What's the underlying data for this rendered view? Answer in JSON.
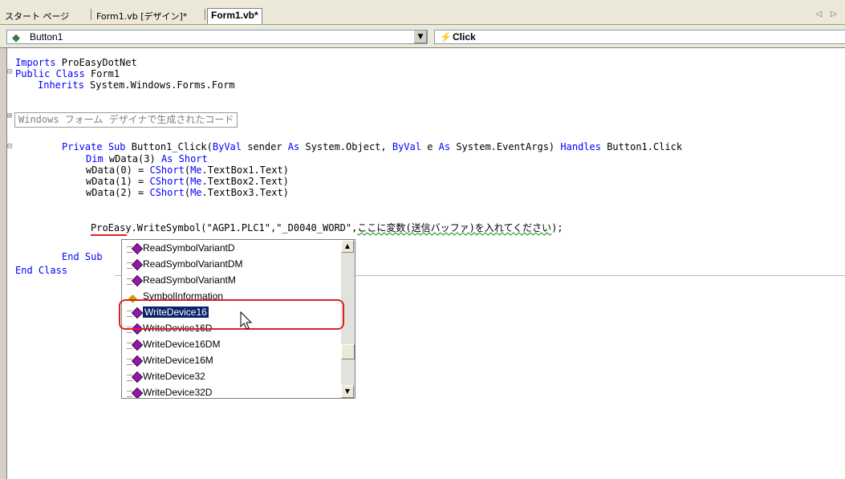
{
  "tabs": [
    "スタート ページ",
    "Form1.vb [デザイン]*",
    "Form1.vb*"
  ],
  "tab_nav": "◁ ▷",
  "object_combo": "Button1",
  "event_combo": "Click",
  "code": {
    "l1_kw": "Imports",
    "l1_rest": " ProEasyDotNet",
    "l2_kw1": "Public",
    "l2_kw2": "Class",
    "l2_rest": " Form1",
    "l3_kw": "Inherits",
    "l3_rest": " System.Windows.Forms.Form",
    "region": "Windows フォーム デザイナで生成されたコード",
    "l5_kw1": "Private",
    "l5_kw2": "Sub",
    "l5_a": " Button1_Click(",
    "l5_kw3": "ByVal",
    "l5_b": " sender ",
    "l5_kw4": "As",
    "l5_c": " System.Object, ",
    "l5_kw5": "ByVal",
    "l5_d": " e ",
    "l5_kw6": "As",
    "l5_e": " System.EventArgs) ",
    "l5_kw7": "Handles",
    "l5_f": " Button1.Click",
    "l6_kw1": "Dim",
    "l6_a": " wData(3) ",
    "l6_kw2": "As",
    "l6_kw3": "Short",
    "l7_a": "wData(0) = ",
    "l7_kw1": "CShort",
    "l7_b": "(",
    "l7_kw2": "Me",
    "l7_c": ".TextBox1.Text)",
    "l8_a": "wData(1) = ",
    "l8_kw1": "CShort",
    "l8_b": "(",
    "l8_kw2": "Me",
    "l8_c": ".TextBox2.Text)",
    "l9_a": "wData(2) = ",
    "l9_kw1": "CShort",
    "l9_b": "(",
    "l9_kw2": "Me",
    "l9_c": ".TextBox3.Text)",
    "l10_a": "ProEasy.",
    "l10_b": "WriteSymbol",
    "l10_c": "(\"AGP1.PLC1\",\"_D0040_WORD\",",
    "l10_d": "ここに変数(送信バッファ)を入れてください",
    "l10_e": ");",
    "end_sub_kw1": "End",
    "end_sub_kw2": "Sub",
    "end_class_kw1": "End",
    "end_class_kw2": "Class"
  },
  "intellisense": {
    "items": [
      {
        "label": "ReadSymbolVariantD",
        "icon": "method-icon"
      },
      {
        "label": "ReadSymbolVariantDM",
        "icon": "method-icon"
      },
      {
        "label": "ReadSymbolVariantM",
        "icon": "method-icon"
      },
      {
        "label": "SymbolInformation",
        "icon": "property-icon"
      },
      {
        "label": "WriteDevice16",
        "icon": "method-icon",
        "selected": true
      },
      {
        "label": "WriteDevice16D",
        "icon": "method-icon"
      },
      {
        "label": "WriteDevice16DM",
        "icon": "method-icon"
      },
      {
        "label": "WriteDevice16M",
        "icon": "method-icon"
      },
      {
        "label": "WriteDevice32",
        "icon": "method-icon"
      },
      {
        "label": "WriteDevice32D",
        "icon": "method-icon"
      }
    ]
  },
  "colors": {
    "keyword": "#0000ff",
    "selection": "#0a246a",
    "highlight_ring": "#e02020"
  }
}
